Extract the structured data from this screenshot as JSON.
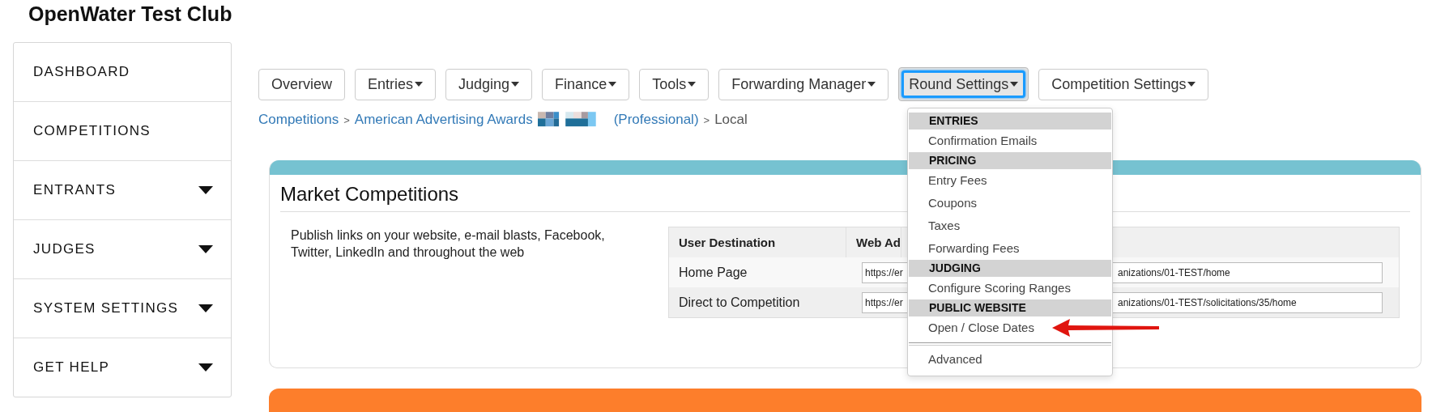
{
  "site_title": "OpenWater Test Club",
  "sidebar": {
    "items": [
      {
        "label": "DASHBOARD",
        "has_caret": false
      },
      {
        "label": "COMPETITIONS",
        "has_caret": false
      },
      {
        "label": "ENTRANTS",
        "has_caret": true
      },
      {
        "label": "JUDGES",
        "has_caret": true
      },
      {
        "label": "SYSTEM SETTINGS",
        "has_caret": true
      },
      {
        "label": "GET HELP",
        "has_caret": true
      }
    ]
  },
  "nav_buttons": [
    {
      "label": "Overview",
      "has_caret": false,
      "open": false
    },
    {
      "label": "Entries",
      "has_caret": true,
      "open": false
    },
    {
      "label": "Judging",
      "has_caret": true,
      "open": false
    },
    {
      "label": "Finance",
      "has_caret": true,
      "open": false
    },
    {
      "label": "Tools",
      "has_caret": true,
      "open": false
    },
    {
      "label": "Forwarding Manager",
      "has_caret": true,
      "open": false
    },
    {
      "label": "Round Settings",
      "has_caret": true,
      "open": true
    },
    {
      "label": "Competition Settings",
      "has_caret": true,
      "open": false
    }
  ],
  "dropdown": {
    "items": [
      {
        "kind": "header",
        "label": "ENTRIES"
      },
      {
        "kind": "item",
        "label": "Confirmation Emails"
      },
      {
        "kind": "header",
        "label": "PRICING"
      },
      {
        "kind": "item",
        "label": "Entry Fees"
      },
      {
        "kind": "item",
        "label": "Coupons"
      },
      {
        "kind": "item",
        "label": "Taxes"
      },
      {
        "kind": "item",
        "label": "Forwarding Fees"
      },
      {
        "kind": "header",
        "label": "JUDGING"
      },
      {
        "kind": "item",
        "label": "Configure Scoring Ranges"
      },
      {
        "kind": "header",
        "label": "PUBLIC WEBSITE"
      },
      {
        "kind": "item",
        "label": "Open / Close Dates",
        "annotated": true
      },
      {
        "kind": "divider"
      },
      {
        "kind": "item",
        "label": "Advanced"
      }
    ]
  },
  "breadcrumb": [
    {
      "kind": "link",
      "label": "Competitions"
    },
    {
      "kind": "separator",
      "label": ">"
    },
    {
      "kind": "link",
      "label": "American Advertising Awards"
    },
    {
      "kind": "redacted"
    },
    {
      "kind": "link",
      "label": "(Professional)"
    },
    {
      "kind": "separator",
      "label": ">"
    },
    {
      "kind": "text",
      "label": "Local"
    }
  ],
  "panel": {
    "title": "Market Competitions",
    "description": "Publish links on your website, e-mail blasts, Facebook, Twitter, LinkedIn and throughout the web",
    "table": {
      "columns": [
        "User Destination",
        "Web Ad"
      ],
      "rows": [
        {
          "destination": "Home Page",
          "url_start": "https://er",
          "url_end": "anizations/01-TEST/home"
        },
        {
          "destination": "Direct to Competition",
          "url_start": "https://er",
          "url_end": "anizations/01-TEST/solicitations/35/home"
        }
      ]
    }
  }
}
